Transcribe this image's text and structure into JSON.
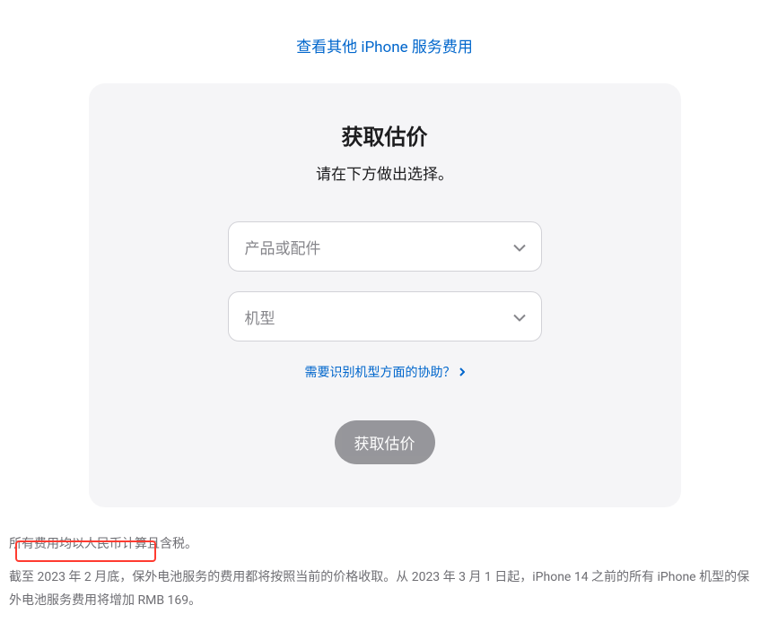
{
  "topLink": {
    "label": "查看其他 iPhone 服务费用"
  },
  "card": {
    "title": "获取估价",
    "subtitle": "请在下方做出选择。",
    "select1": {
      "placeholder": "产品或配件"
    },
    "select2": {
      "placeholder": "机型"
    },
    "helpLink": "需要识别机型方面的协助？",
    "submitLabel": "获取估价"
  },
  "footer": {
    "line1": "所有费用均以人民币计算且含税。",
    "line2": "截至 2023 年 2 月底，保外电池服务的费用都将按照当前的价格收取。从 2023 年 3 月 1 日起，iPhone 14 之前的所有 iPhone 机型的保外电池服务费用将增加 RMB 169。"
  }
}
